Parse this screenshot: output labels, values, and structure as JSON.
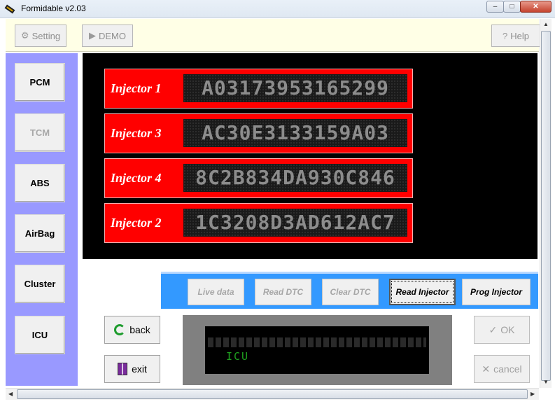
{
  "window": {
    "title": "Formidable v2.03",
    "controls": [
      "–",
      "□",
      "✕"
    ]
  },
  "toolbar": {
    "setting_label": "Setting",
    "demo_label": "DEMO",
    "help_label": "Help"
  },
  "nav": [
    {
      "label": "PCM",
      "enabled": true
    },
    {
      "label": "TCM",
      "enabled": false
    },
    {
      "label": "ABS",
      "enabled": true
    },
    {
      "label": "AirBag",
      "enabled": true
    },
    {
      "label": "Cluster",
      "enabled": true
    },
    {
      "label": "ICU",
      "enabled": true
    }
  ],
  "injectors": [
    {
      "label": "Injector 1",
      "code": "A03173953165299"
    },
    {
      "label": "Injector 3",
      "code": "AC30E3133159A03"
    },
    {
      "label": "Injector 4",
      "code": "8C2B834DA930C846"
    },
    {
      "label": "Injector 2",
      "code": "1C3208D3AD612AC7"
    }
  ],
  "functions": [
    {
      "label": "Live data",
      "enabled": false
    },
    {
      "label": "Read DTC",
      "enabled": false
    },
    {
      "label": "Clear DTC",
      "enabled": false
    },
    {
      "label": "Read Injector",
      "enabled": true
    },
    {
      "label": "Prog Injector",
      "enabled": true
    }
  ],
  "actions": {
    "back_label": "back",
    "exit_label": "exit",
    "ok_label": "OK",
    "cancel_label": "cancel"
  },
  "lcd": {
    "line2": "ICU"
  },
  "colors": {
    "nav_bg": "#9999ff",
    "injector_bg": "#ff0000",
    "function_bar": "#3399ff",
    "toolbar_bg": "#ffffe6",
    "lcd_text": "#1fa01f"
  }
}
